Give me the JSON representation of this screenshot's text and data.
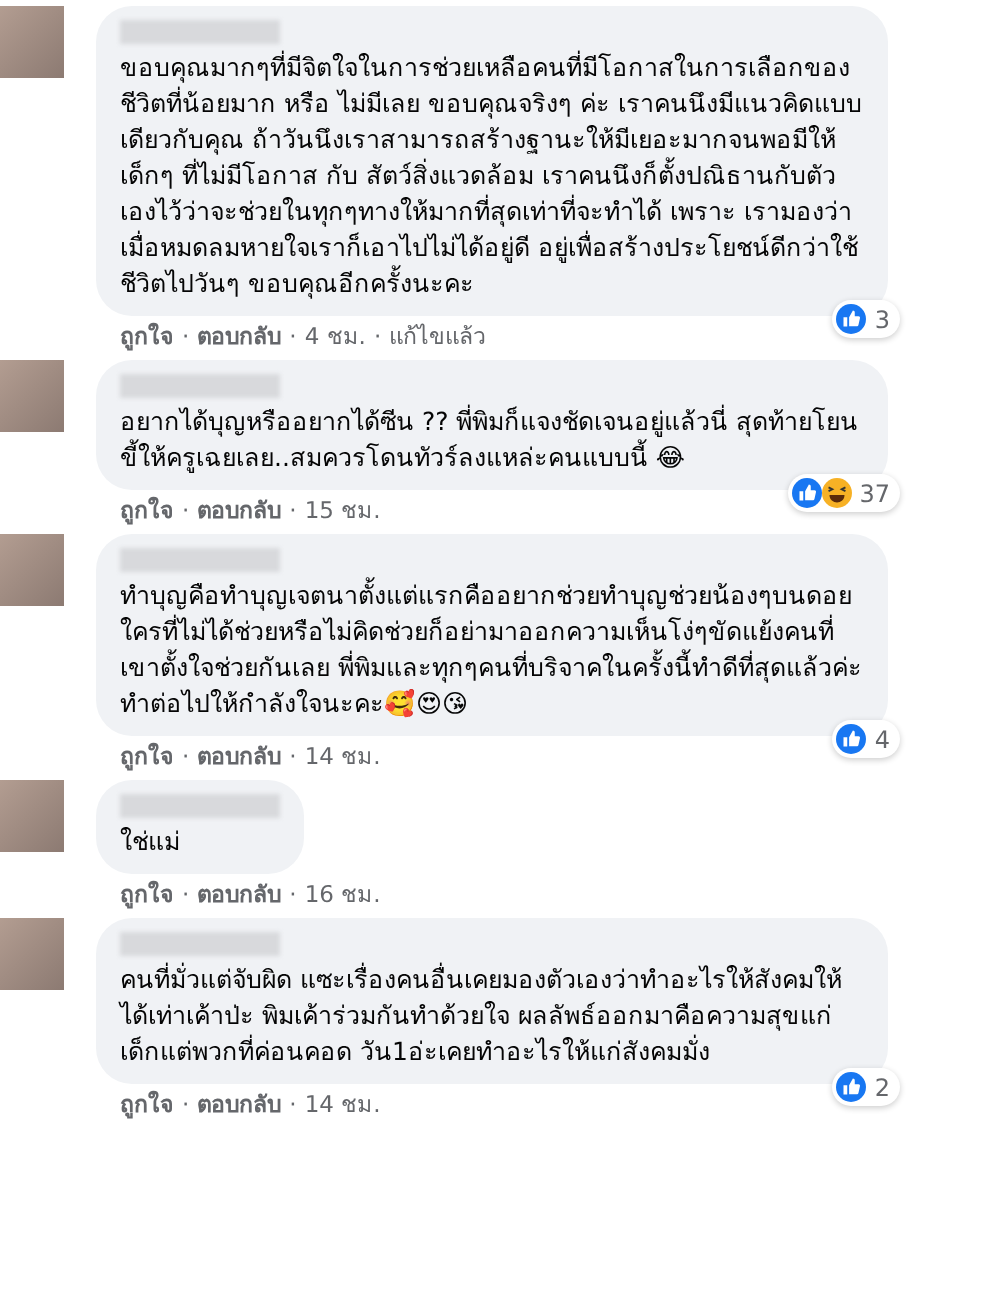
{
  "comments": [
    {
      "text": "ขอบคุณมากๆที่มีจิตใจในการช่วยเหลือคนที่มีโอกาสในการเลือกของชีวิตที่น้อยมาก หรือ ไม่มีเลย ขอบคุณจริงๆ ค่ะ เราคนนึงมีแนวคิดแบบเดียวกับคุณ ถ้าวันนึงเราสามารถสร้างฐานะให้มีเยอะมากจนพอมีให้เด็กๆ ที่ไม่มีโอกาส กับ สัตว์สิ่งแวดล้อม เราคนนึงก็ตั้งปณิธานกับตัวเองไว้ว่าจะช่วยในทุกๆทางให้มากที่สุดเท่าที่จะทำได้ เพราะ เรามองว่าเมื่อหมดลมหายใจเราก็เอาไปไม่ได้อยู่ดี อยู่เพื่อสร้างประโยชน์ดีกว่าใช้ชีวิตไปวันๆ ขอบคุณอีกครั้งนะคะ",
      "reactions": [
        {
          "kind": "like"
        }
      ],
      "reaction_count": "3",
      "actions": [
        {
          "kind": "like",
          "text": "ถูกใจ"
        },
        {
          "kind": "sep",
          "text": "·"
        },
        {
          "kind": "reply",
          "text": "ตอบกลับ"
        },
        {
          "kind": "sep",
          "text": "·"
        },
        {
          "kind": "time",
          "text": "4 ชม."
        },
        {
          "kind": "sep",
          "text": "·"
        },
        {
          "kind": "edited",
          "text": "แก้ไขแล้ว"
        }
      ]
    },
    {
      "text": "อยากได้บุญหรืออยากได้ซีน ?? พี่พิมก็แจงชัดเจนอยู่แล้วนี่ สุดท้ายโยนขี้ให้ครูเฉยเลย..สมควรโดนทัวร์ลงแหล่ะคนแบบนี้ 😂",
      "reactions": [
        {
          "kind": "like"
        },
        {
          "kind": "haha"
        }
      ],
      "reaction_count": "37",
      "actions": [
        {
          "kind": "like",
          "text": "ถูกใจ"
        },
        {
          "kind": "sep",
          "text": "·"
        },
        {
          "kind": "reply",
          "text": "ตอบกลับ"
        },
        {
          "kind": "sep",
          "text": "·"
        },
        {
          "kind": "time",
          "text": "15 ชม."
        }
      ]
    },
    {
      "text": "ทำบุญคือทำบุญเจตนาตั้งแต่แรกคืออยากช่วยทำบุญช่วยน้องๆบนดอยใครที่ไม่ได้ช่วยหรือไม่คิดช่วยก็อย่ามาออกความเห็นโง่ๆขัดแย้งคนที่เขาตั้งใจช่วยกันเลย พี่พิมและทุกๆคนที่บริจาคในครั้งนี้ทำดีที่สุดแล้วค่ะทำต่อไปให้กำลังใจนะคะ🥰😍😘",
      "reactions": [
        {
          "kind": "like"
        }
      ],
      "reaction_count": "4",
      "actions": [
        {
          "kind": "like",
          "text": "ถูกใจ"
        },
        {
          "kind": "sep",
          "text": "·"
        },
        {
          "kind": "reply",
          "text": "ตอบกลับ"
        },
        {
          "kind": "sep",
          "text": "·"
        },
        {
          "kind": "time",
          "text": "14 ชม."
        }
      ]
    },
    {
      "text": "ใช่แม่",
      "actions": [
        {
          "kind": "like",
          "text": "ถูกใจ"
        },
        {
          "kind": "sep",
          "text": "·"
        },
        {
          "kind": "reply",
          "text": "ตอบกลับ"
        },
        {
          "kind": "sep",
          "text": "·"
        },
        {
          "kind": "time",
          "text": "16 ชม."
        }
      ]
    },
    {
      "text": "คนที่มั่วแต่จับผิด แซะเรื่องคนอื่นเคยมองตัวเองว่าทำอะไรให้สังคมให้ได้เท่าเค้าป่ะ พิมเค้าร่วมกันทำด้วยใจ ผลลัพธ์ออกมาคือความสุขแก่เด็กแต่พวกที่ค่อนคอด วัน1อ่ะเคยทำอะไรให้แก่สังคมมั่ง",
      "reactions": [
        {
          "kind": "like"
        }
      ],
      "reaction_count": "2",
      "actions": [
        {
          "kind": "like",
          "text": "ถูกใจ"
        },
        {
          "kind": "sep",
          "text": "·"
        },
        {
          "kind": "reply",
          "text": "ตอบกลับ"
        },
        {
          "kind": "sep",
          "text": "·"
        },
        {
          "kind": "time",
          "text": "14 ชม."
        }
      ]
    }
  ]
}
